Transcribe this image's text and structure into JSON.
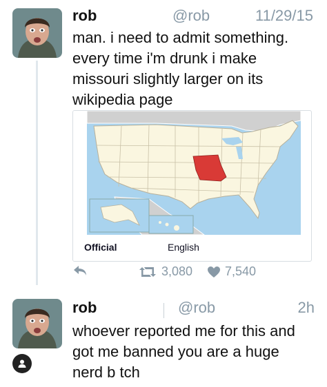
{
  "colors": {
    "accent_state": "#d93a36",
    "muted": "#8899a6",
    "water": "#a9d3ee",
    "land": "#faf6e0"
  },
  "tweets": [
    {
      "author": "rob",
      "handle": "@rob",
      "time": "11/29/15",
      "lines": [
        "man. i need to admit something.",
        "every time i'm drunk i make",
        "missouri slightly larger on its",
        "wikipedia page"
      ],
      "media": {
        "icon": "us-map-missouri-highlighted",
        "caption_official": "Official",
        "caption_english": "English"
      },
      "actions": {
        "reply_icon": "reply-icon",
        "retweet_icon": "retweet-icon",
        "retweet_count": "3,080",
        "like_icon": "heart-icon",
        "like_count": "7,540"
      }
    },
    {
      "author": "rob",
      "handle": "@rob",
      "time": "2h",
      "lines": [
        "whoever reported me for this and",
        "got me banned you are a huge",
        "nerd b tch"
      ],
      "badge_icon": "user-icon"
    }
  ]
}
